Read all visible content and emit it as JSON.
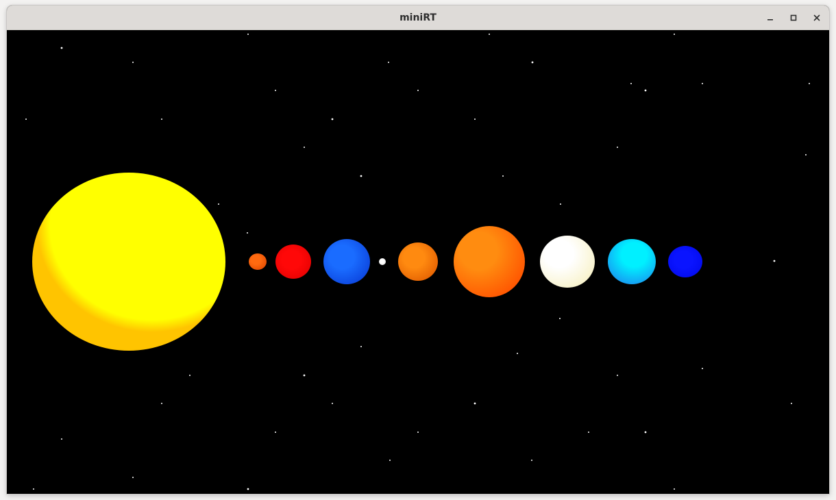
{
  "window": {
    "title": "miniRT",
    "controls": [
      {
        "name": "minimize-button",
        "icon": "minimize-icon"
      },
      {
        "name": "maximize-button",
        "icon": "maximize-icon"
      },
      {
        "name": "close-button",
        "icon": "close-icon"
      }
    ]
  },
  "scene": {
    "background": "#000000",
    "bodies": [
      {
        "name": "sun",
        "color": "#ffff00",
        "shade": "#ffc400"
      },
      {
        "name": "planet-mercury",
        "color": "#ff6a10",
        "shade": "#e04800"
      },
      {
        "name": "planet-venus",
        "color": "#ff0808",
        "shade": "#e00000"
      },
      {
        "name": "planet-earth",
        "color": "#1a6cff",
        "shade": "#0a3ed8"
      },
      {
        "name": "moon",
        "color": "#ffffff",
        "shade": "#dddddd"
      },
      {
        "name": "planet-mars",
        "color": "#ff8a10",
        "shade": "#e05a00"
      },
      {
        "name": "planet-jupiter",
        "color": "#ff8c10",
        "shade": "#ff5200"
      },
      {
        "name": "planet-saturn",
        "color": "#ffffff",
        "shade": "#f8f2c8"
      },
      {
        "name": "planet-uranus",
        "color": "#00f0ff",
        "shade": "#1a8cf0"
      },
      {
        "name": "planet-neptune",
        "color": "#0a14ff",
        "shade": "#0008e8"
      }
    ],
    "star_color": "#ffffff"
  }
}
